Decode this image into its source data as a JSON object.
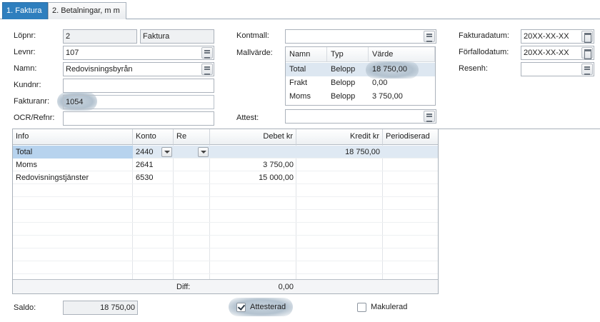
{
  "tabs": [
    "1. Faktura",
    "2. Betalningar, m m"
  ],
  "fields": {
    "lopnr_label": "Löpnr:",
    "lopnr_value": "2",
    "lopnr_type": "Faktura",
    "levnr_label": "Levnr:",
    "levnr_value": "107",
    "namn_label": "Namn:",
    "namn_value": "Redovisningsbyrån",
    "kundnr_label": "Kundnr:",
    "kundnr_value": "",
    "fakturanr_label": "Fakturanr:",
    "fakturanr_value": "1054",
    "ocr_label": "OCR/Refnr:",
    "ocr_value": "",
    "kontmall_label": "Kontmall:",
    "kontmall_value": "",
    "mallvarde_label": "Mallvärde:",
    "attest_label": "Attest:",
    "attest_value": "",
    "fakturadatum_label": "Fakturadatum:",
    "fakturadatum_value": "20XX-XX-XX",
    "forfallodatum_label": "Förfallodatum:",
    "forfallodatum_value": "20XX-XX-XX",
    "resenh_label": "Resenh:",
    "resenh_value": ""
  },
  "mallvarde": {
    "headers": [
      "Namn",
      "Typ",
      "Värde"
    ],
    "rows": [
      [
        "Total",
        "Belopp",
        "18 750,00"
      ],
      [
        "Frakt",
        "Belopp",
        "0,00"
      ],
      [
        "Moms",
        "Belopp",
        "3 750,00"
      ]
    ]
  },
  "grid": {
    "headers": [
      "Info",
      "Konto",
      "Re",
      "Debet kr",
      "Kredit kr",
      "Periodiserad"
    ],
    "rows": [
      {
        "info": "Total",
        "konto": "2440",
        "debet": "",
        "kredit": "18 750,00"
      },
      {
        "info": "Moms",
        "konto": "2641",
        "debet": "3 750,00",
        "kredit": ""
      },
      {
        "info": "Redovisningstjänster",
        "konto": "6530",
        "debet": "15 000,00",
        "kredit": ""
      }
    ],
    "diff_label": "Diff:",
    "diff_value": "0,00"
  },
  "bottom": {
    "saldo_label": "Saldo:",
    "saldo_value": "18 750,00",
    "attesterad_label": "Attesterad",
    "attesterad_checked": true,
    "makulerad_label": "Makulerad",
    "makulerad_checked": false
  },
  "icons": {
    "lookup": "list-lookup-icon",
    "calendar": "calendar-icon",
    "dropdown": "chevron-down-icon",
    "check": "checkmark-icon"
  },
  "colors": {
    "tab_active": "#2f7fbe",
    "selected_row": "#b7d3ee",
    "highlight_halo": "#b3c2cf"
  }
}
